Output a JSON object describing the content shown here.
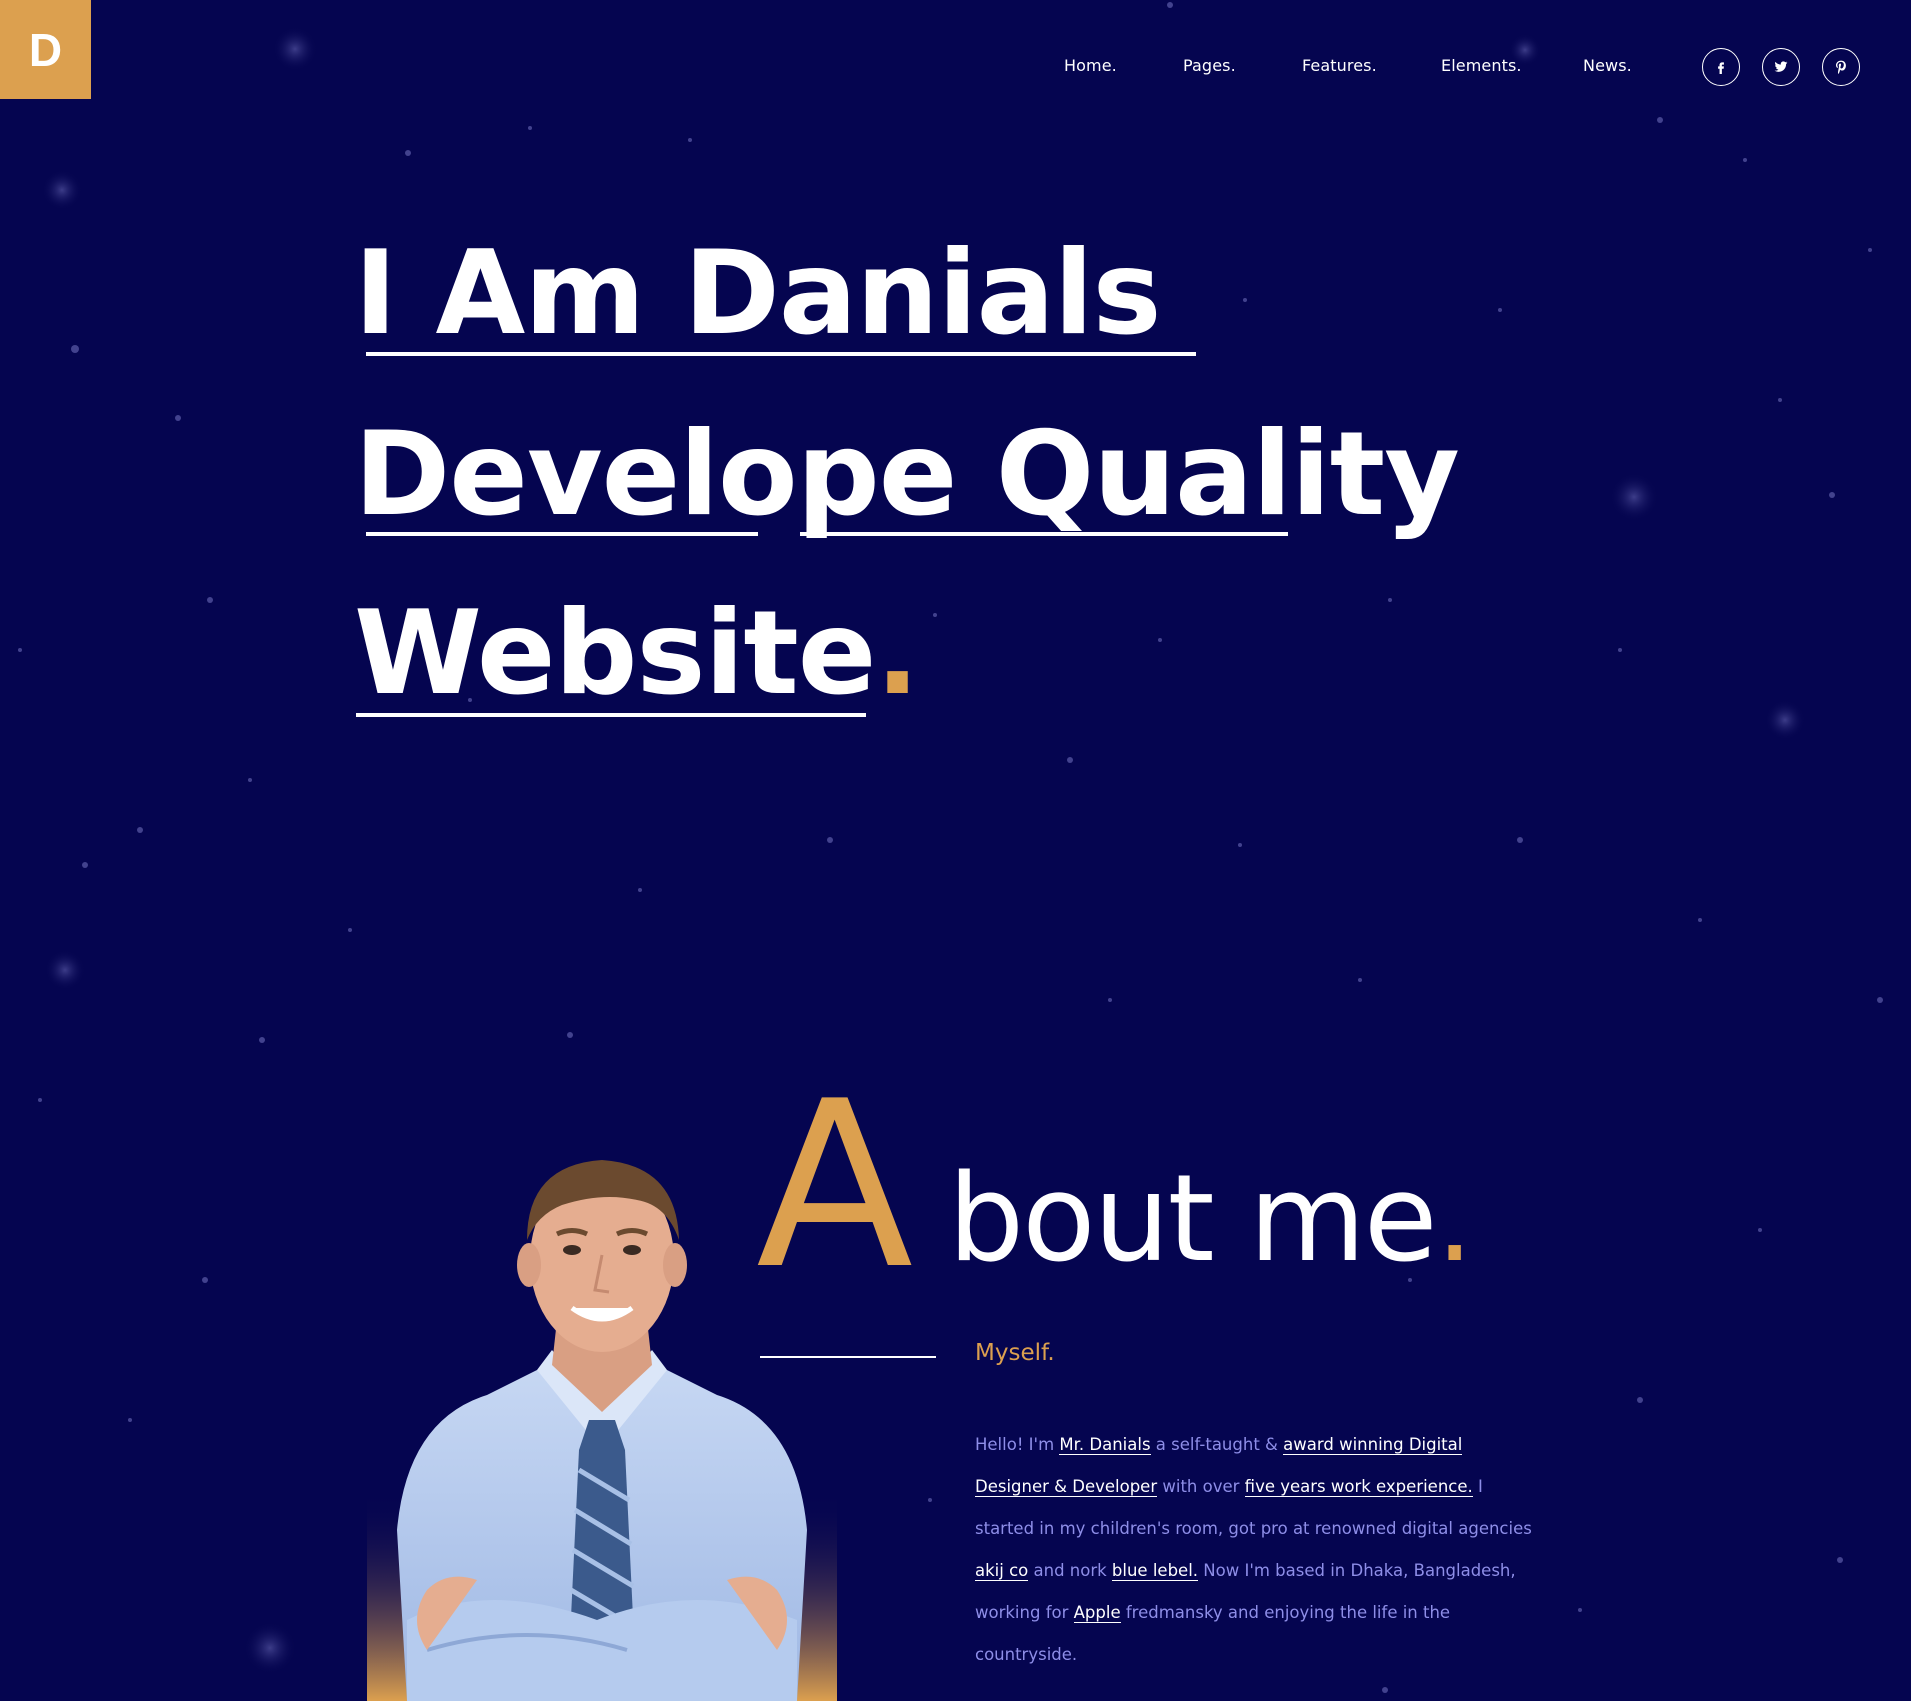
{
  "brand": {
    "logo_letter": "D",
    "accent_color": "#dca04f",
    "background_color": "#050550"
  },
  "nav": {
    "items": [
      "Home.",
      "Pages.",
      "Features.",
      "Elements.",
      "News."
    ]
  },
  "social": {
    "icons": [
      "facebook-icon",
      "twitter-icon",
      "pinterest-icon"
    ]
  },
  "hero": {
    "line1": "I Am Danials",
    "line2": "Develope Quality",
    "line3": "Website",
    "dot": "."
  },
  "about": {
    "big_letter": "A",
    "title_rest": "bout me",
    "dot": ".",
    "subtitle": "Myself.",
    "bio": {
      "t1": "Hello! I'm ",
      "name": "Mr. Danials",
      "t2": " a self-taught & ",
      "role": "award winning Digital Designer & Developer",
      "t3": " with over ",
      "experience": "five years work experience.",
      "t4": " I started in my children's room, got pro at renowned digital agencies ",
      "agency1": "akij co",
      "t5": " and nork ",
      "agency2": "blue lebel.",
      "t6": " Now I'm based in Dhaka, Bangladesh, working for ",
      "company": "Apple",
      "t7": " fredmansky and enjoying the life in the countryside."
    }
  }
}
